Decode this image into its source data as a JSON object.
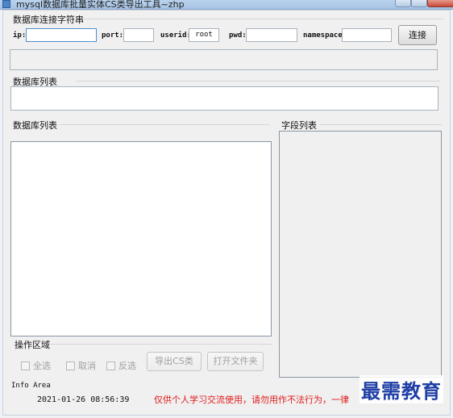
{
  "window": {
    "title": "mysql数据库批量实体CS类导出工具~zhp"
  },
  "connection": {
    "group_label": "数据库连接字符串",
    "ip_label": "ip:",
    "ip_value": "",
    "port_label": "port:",
    "port_value": "",
    "userid_label": "userid:",
    "userid_value": "root",
    "pwd_label": "pwd:",
    "pwd_value": "",
    "namespace_label": "namespace:",
    "namespace_value": "",
    "connect_button": "连接"
  },
  "database_list_top": {
    "label": "数据库列表"
  },
  "database_list": {
    "label": "数据库列表"
  },
  "field_list": {
    "label": "字段列表"
  },
  "operations": {
    "label": "操作区域",
    "select_all": "全选",
    "cancel": "取消",
    "invert": "反选",
    "export_button": "导出CS类",
    "open_folder_button": "打开文件夹"
  },
  "info": {
    "label": "Info Area",
    "timestamp": "2021-01-26 08:56:39",
    "notice": "仅供个人学习交流使用，请勿用作不法行为，一律"
  },
  "watermark": {
    "text": "最需教育"
  }
}
